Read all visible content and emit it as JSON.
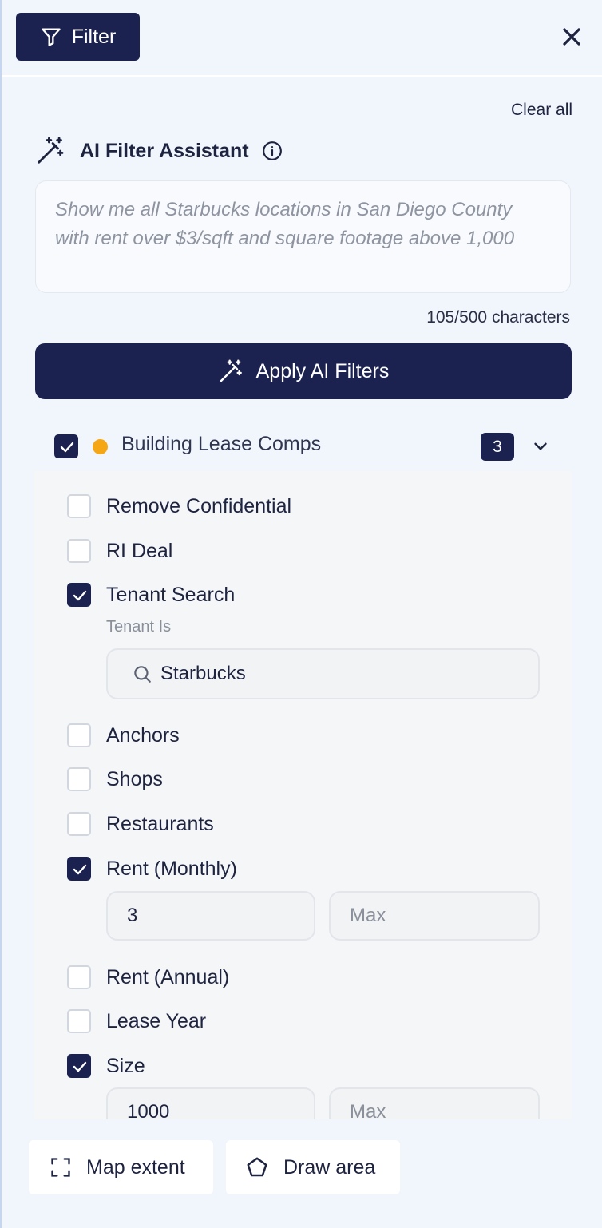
{
  "header": {
    "filter_label": "Filter"
  },
  "clear_all": "Clear all",
  "ai_assistant": {
    "title": "AI Filter Assistant",
    "prompt_text": "Show me all Starbucks locations in San Diego County with rent over $3/sqft and square footage above 1,000",
    "char_count": "105/500 characters",
    "apply_label": "Apply AI Filters"
  },
  "category": {
    "label": "Building Lease Comps",
    "checked": true,
    "dot_color": "#f4a614",
    "count": "3"
  },
  "options": [
    {
      "label": "Remove Confidential",
      "checked": false
    },
    {
      "label": "RI Deal",
      "checked": false
    },
    {
      "label": "Tenant Search",
      "checked": true
    },
    {
      "label": "Anchors",
      "checked": false
    },
    {
      "label": "Shops",
      "checked": false
    },
    {
      "label": "Restaurants",
      "checked": false
    },
    {
      "label": "Rent (Monthly)",
      "checked": true
    },
    {
      "label": "Rent (Annual)",
      "checked": false
    },
    {
      "label": "Lease Year",
      "checked": false
    },
    {
      "label": "Size",
      "checked": true
    }
  ],
  "tenant": {
    "sub_label": "Tenant Is",
    "value": "Starbucks"
  },
  "rent_monthly": {
    "min": "3",
    "max_placeholder": "Max"
  },
  "size": {
    "min": "1000",
    "max_placeholder": "Max"
  },
  "footer": {
    "map_extent": "Map extent",
    "draw_area": "Draw area"
  },
  "colors": {
    "primary": "#1c2250",
    "accent": "#f4a614",
    "panel_bg": "#f1f5fc"
  }
}
